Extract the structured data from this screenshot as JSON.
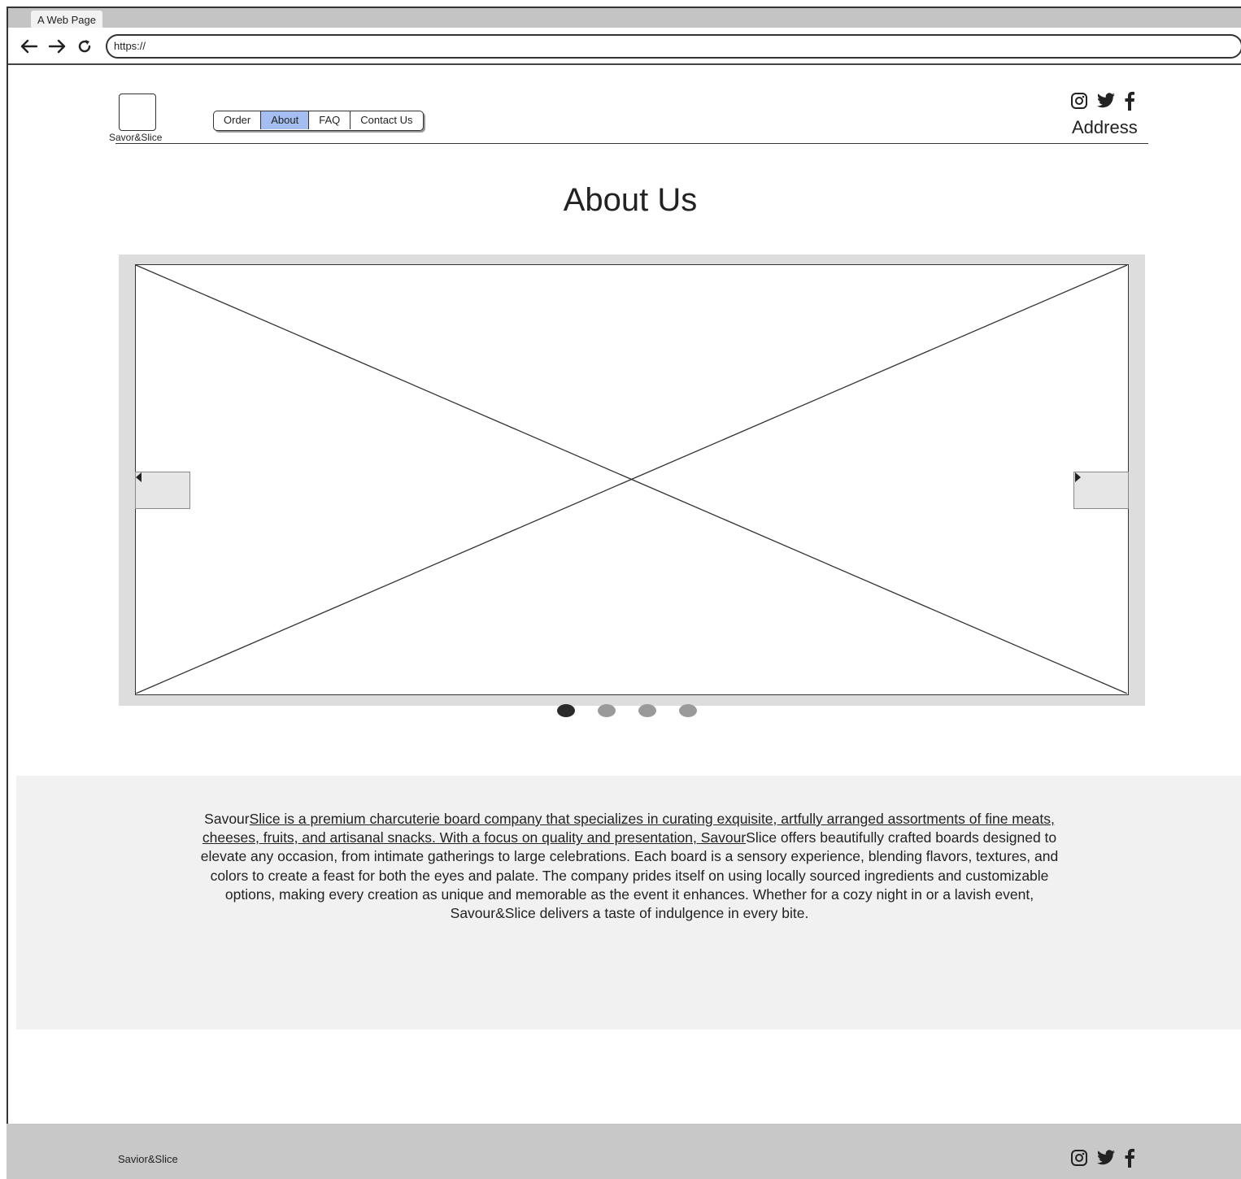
{
  "browser": {
    "tab_title": "A Web Page",
    "url": "https://"
  },
  "header": {
    "logo_text": "Savor&Slice",
    "menu": [
      {
        "label": "Order",
        "active": false
      },
      {
        "label": "About",
        "active": true
      },
      {
        "label": "FAQ",
        "active": false
      },
      {
        "label": "Contact Us",
        "active": false
      }
    ],
    "social_icons": [
      "instagram-icon",
      "twitter-icon",
      "facebook-icon"
    ],
    "address": "Address"
  },
  "main": {
    "title": "About Us",
    "carousel": {
      "slide_count": 4,
      "active_slide": 1
    },
    "description": {
      "part1": "Savour",
      "part2_underlined": "Slice is a premium charcuterie board company that specializes in curating exquisite, artfully arranged assortments of fine meats, cheeses, fruits, and artisanal snacks. With a focus on quality and presentation, Savour",
      "part3": "Slice offers beautifully crafted boards designed to elevate any occasion, from intimate gatherings to large celebrations. Each board is a sensory experience, blending flavors, textures, and colors to create a feast for both the eyes and palate. The company prides itself on using locally sourced ingredients and customizable options, making every creation as unique and memorable as the event it enhances. Whether for a cozy night in or a lavish event, Savour&Slice delivers a taste of indulgence in every bite."
    }
  },
  "footer": {
    "brand": "Savior&Slice",
    "social_icons": [
      "instagram-icon",
      "twitter-icon",
      "facebook-icon"
    ]
  },
  "colors": {
    "active_menu": "#a4bef2",
    "footer_bg": "#c8c8c8",
    "panel_bg": "#f1f1f1"
  }
}
